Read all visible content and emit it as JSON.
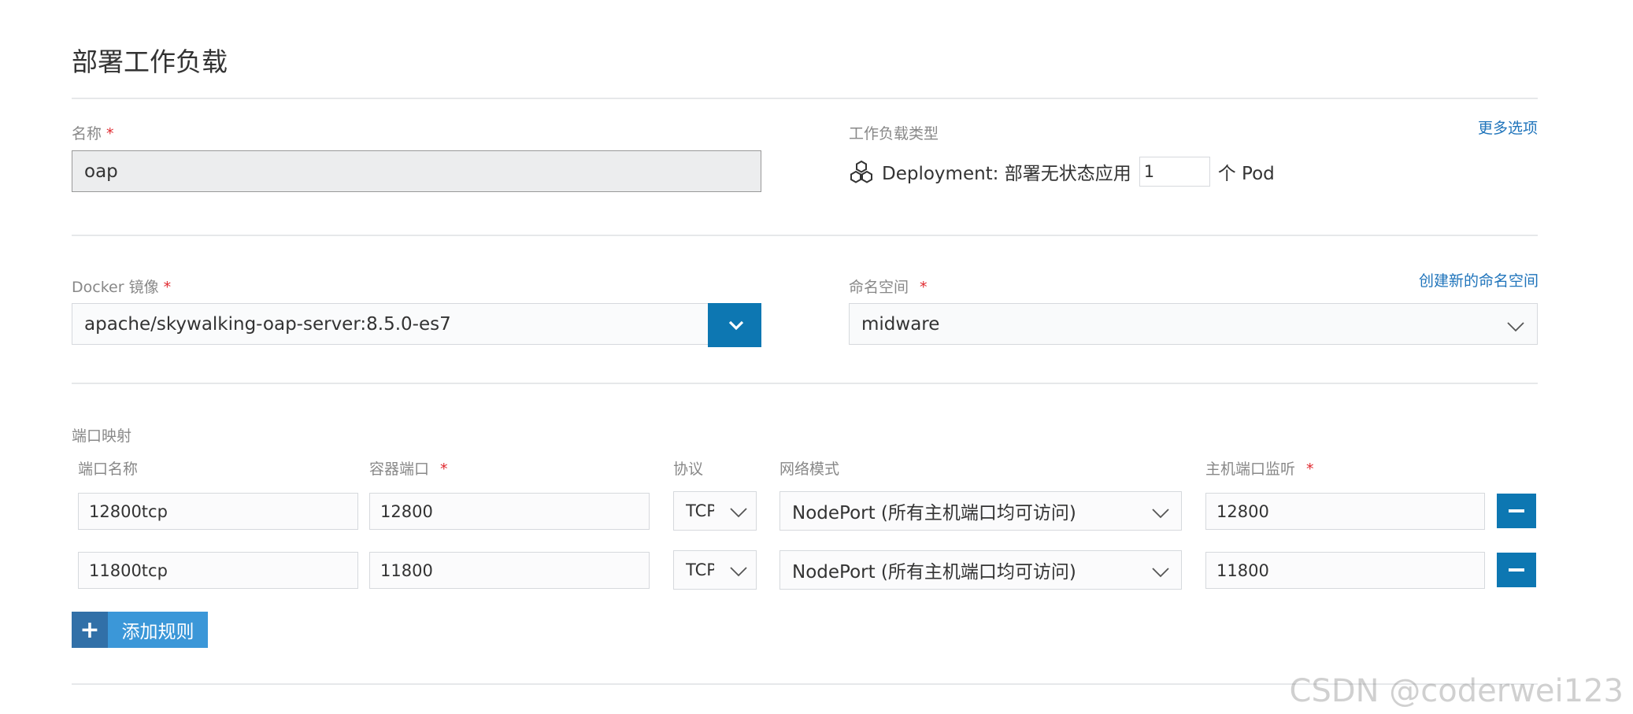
{
  "page": {
    "title": "部署工作负载"
  },
  "name_field": {
    "label": "名称",
    "required": "*",
    "value": "oap"
  },
  "workload_type": {
    "label": "工作负载类型",
    "more_options": "更多选项",
    "icon": "cube-cluster-icon",
    "type_text": "Deployment: 部署无状态应用",
    "replicas": "1",
    "suffix": "个 Pod"
  },
  "docker_image": {
    "label": "Docker 镜像",
    "required": "*",
    "value": "apache/skywalking-oap-server:8.5.0-es7",
    "dropdown_icon": "chevron-down-icon"
  },
  "namespace": {
    "label": "命名空间",
    "required": "*",
    "create_link": "创建新的命名空间",
    "value": "midware"
  },
  "ports": {
    "section_label": "端口映射",
    "headers": {
      "name": "端口名称",
      "container_port": "容器端口",
      "container_port_req": "*",
      "protocol": "协议",
      "network_mode": "网络模式",
      "host_port": "主机端口监听",
      "host_port_req": "*"
    },
    "rows": [
      {
        "name": "12800tcp",
        "container_port": "12800",
        "protocol": "TCP",
        "network_mode": "NodePort (所有主机端口均可访问)",
        "host_port": "12800"
      },
      {
        "name": "11800tcp",
        "container_port": "11800",
        "protocol": "TCP",
        "network_mode": "NodePort (所有主机端口均可访问)",
        "host_port": "11800"
      }
    ],
    "add_button": {
      "icon": "plus",
      "label": "添加规则"
    }
  },
  "watermark": "CSDN @coderwei123",
  "colors": {
    "primary_blue": "#0d77b2",
    "link_blue": "#1f74bb",
    "required_red": "#e0292f"
  }
}
